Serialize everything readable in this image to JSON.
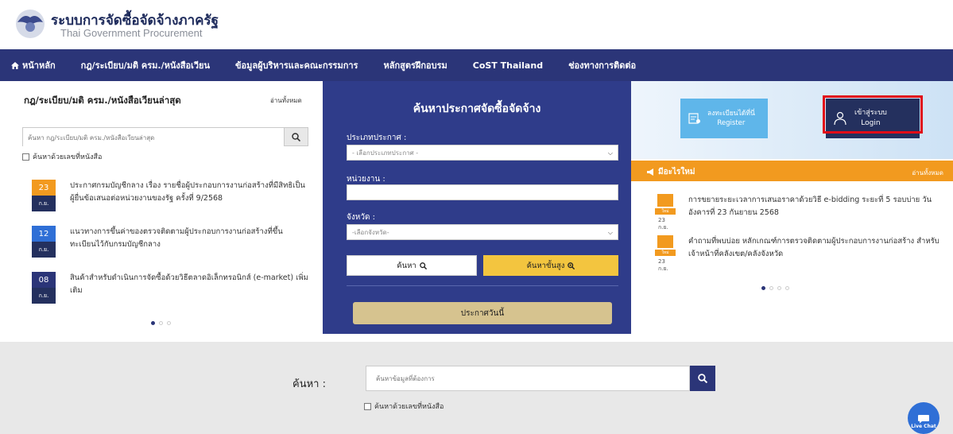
{
  "header": {
    "title": "ระบบการจัดซื้อจัดจ้างภาครัฐ",
    "subtitle": "Thai Government Procurement"
  },
  "nav": {
    "items": [
      {
        "label": "หน้าหลัก",
        "icon": "home-icon"
      },
      {
        "label": "กฎ/ระเบียบ/มติ ครม./หนังสือเวียน"
      },
      {
        "label": "ข้อมูลผู้บริหารและคณะกรรมการ"
      },
      {
        "label": "หลักสูตรฝึกอบรม"
      },
      {
        "label": "CoST Thailand"
      },
      {
        "label": "ช่องทางการติดต่อ"
      }
    ]
  },
  "left": {
    "title": "กฎ/ระเบียบ/มติ ครม./หนังสือเวียนล่าสุด",
    "view_all": "อ่านทั้งหมด",
    "search_placeholder": "ค้นหา กฎ/ระเบียบ/มติ ครม./หนังสือเวียนล่าสุด",
    "checkbox_label": "ค้นหาด้วยเลขที่หนังสือ",
    "news": [
      {
        "day": "23",
        "month": "ก.ย.",
        "color": "#f29a1f",
        "text": "ประกาศกรมบัญชีกลาง เรื่อง รายชื่อผู้ประกอบการงานก่อสร้างที่มีสิทธิเป็นผู้ยื่นข้อเสนอต่อหน่วยงานของรัฐ ครั้งที่ 9/2568"
      },
      {
        "day": "12",
        "month": "ก.ย.",
        "color": "#2f6fd6",
        "text": "แนวทางการขึ้นค่าของตรวจติดตามผู้ประกอบการงานก่อสร้างที่ขึ้นทะเบียนไว้กับกรมบัญชีกลาง"
      },
      {
        "day": "08",
        "month": "ก.ย.",
        "color": "#2b3578",
        "text": "สินค้าสำหรับดำเนินการจัดซื้อด้วยวิธีตลาดอิเล็กทรอนิกส์ (e-market) เพิ่มเติม"
      }
    ]
  },
  "center": {
    "title": "ค้นหาประกาศจัดซื้อจัดจ้าง",
    "type_label": "ประเภทประกาศ :",
    "type_value": "- เลือกประเภทประกาศ -",
    "agency_label": "หน่วยงาน :",
    "province_label": "จังหวัด :",
    "province_value": "-เลือกจังหวัด-",
    "search_button": "ค้นหา",
    "advanced_button": "ค้นหาขั้นสูง",
    "today_button": "ประกาศวันนี้"
  },
  "right": {
    "register_line1": "ลงทะเบียนได้ที่นี่",
    "register_line2": "Register",
    "login_line1": "เข้าสู่ระบบ",
    "login_line2": "Login",
    "updates_title": "มีอะไรใหม่",
    "updates_all": "อ่านทั้งหมด",
    "updates": [
      {
        "tag": "ใหม่",
        "date": "23 ก.ย.",
        "text": "การขยายระยะเวลาการเสนอราคาด้วยวิธี e-bidding ระยะที่ 5 รอบบ่าย วันอังคารที่ 23 กันยายน 2568"
      },
      {
        "tag": "ใหม่",
        "date": "23 ก.ย.",
        "text": "คำถามที่พบบ่อย หลักเกณฑ์การตรวจติดตามผู้ประกอบการงานก่อสร้าง สำหรับเจ้าหน้าที่คลังเขต/คลังจังหวัด"
      }
    ]
  },
  "bottom": {
    "label": "ค้นหา :",
    "placeholder": "ค้นหาข้อมูลที่ต้องการ",
    "checkbox_label": "ค้นหาด้วยเลขที่หนังสือ"
  },
  "live_chat": "Live Chat"
}
